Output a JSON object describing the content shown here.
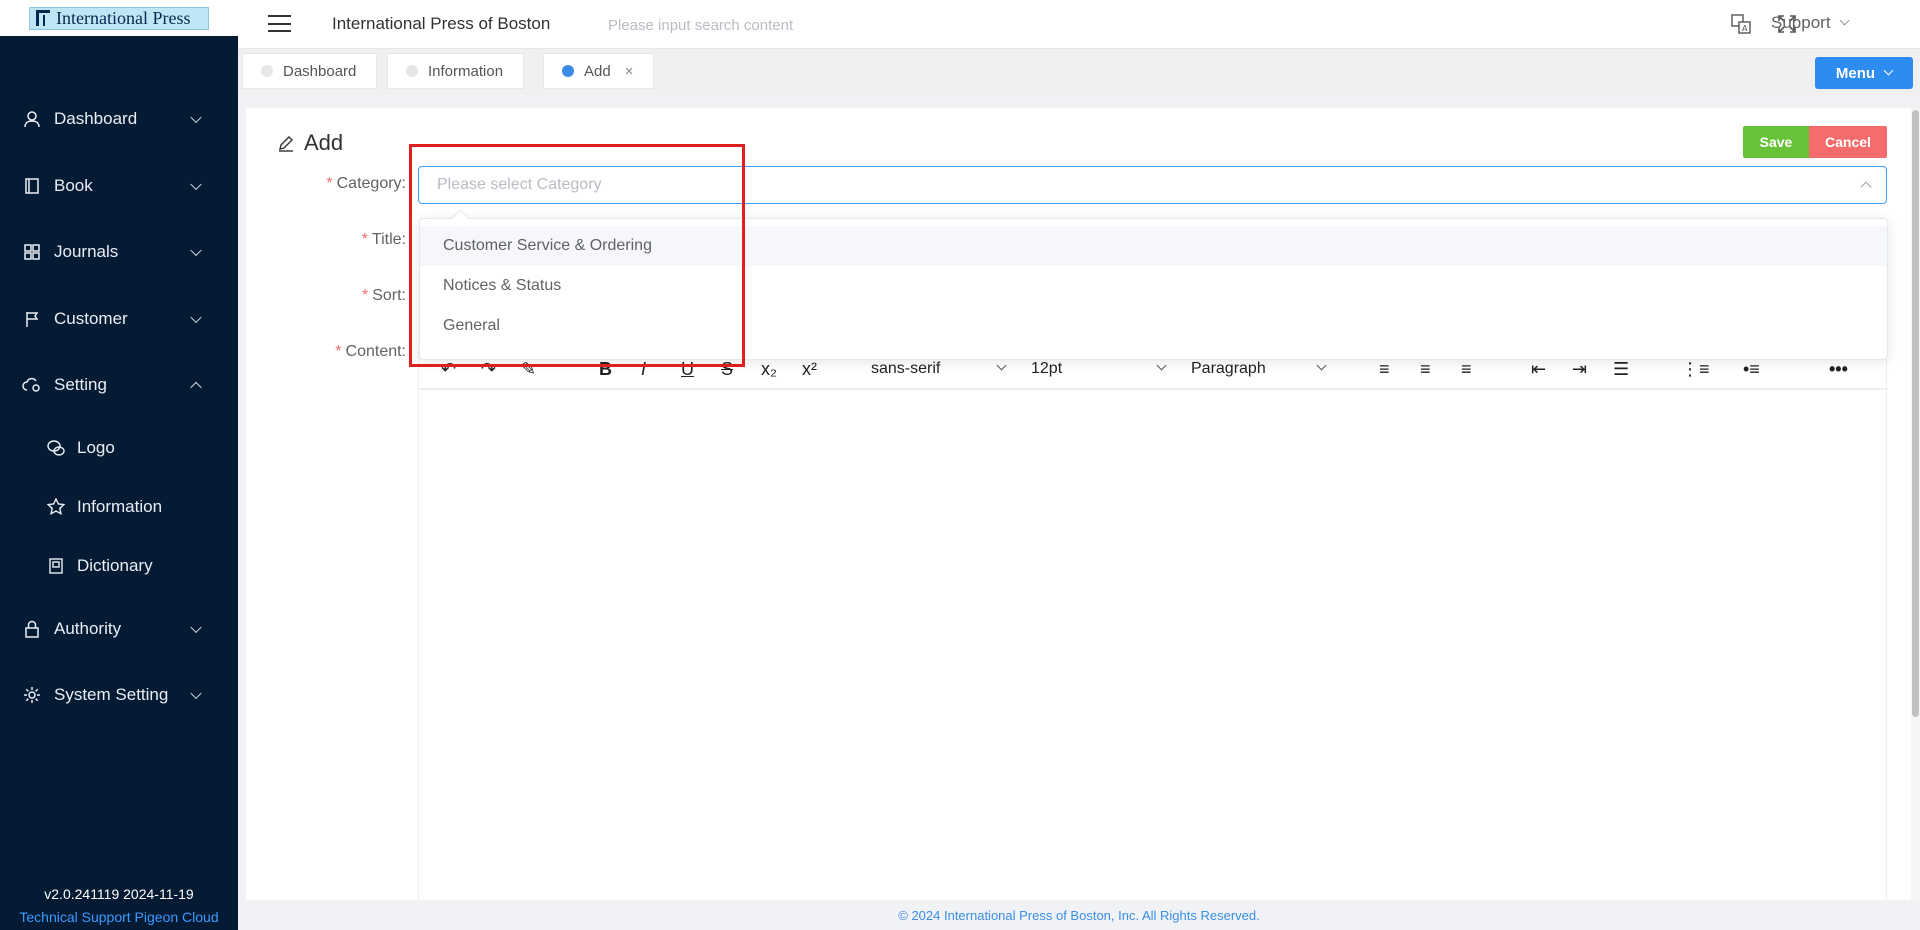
{
  "logo": {
    "text": "International Press"
  },
  "sidebar": {
    "items": [
      {
        "label": "Dashboard",
        "icon": "user-icon"
      },
      {
        "label": "Book",
        "icon": "book-icon"
      },
      {
        "label": "Journals",
        "icon": "grid-icon"
      },
      {
        "label": "Customer",
        "icon": "flag-icon"
      },
      {
        "label": "Setting",
        "icon": "cloud-gear-icon",
        "expanded": true
      }
    ],
    "sub_items": [
      {
        "label": "Logo",
        "icon": "chat-icon"
      },
      {
        "label": "Information",
        "icon": "star-icon"
      },
      {
        "label": "Dictionary",
        "icon": "notebook-icon"
      }
    ],
    "items_after": [
      {
        "label": "Authority",
        "icon": "lock-icon"
      },
      {
        "label": "System Setting",
        "icon": "gear-icon"
      }
    ],
    "version": "v2.0.241119 2024-11-19",
    "support_link": "Technical Support Pigeon Cloud"
  },
  "header": {
    "title": "International Press of Boston",
    "search_placeholder": "Please input search content",
    "support_label": "Support"
  },
  "tabs": [
    {
      "label": "Dashboard",
      "active": false
    },
    {
      "label": "Information",
      "active": false
    },
    {
      "label": "Add",
      "active": true,
      "close": "×"
    }
  ],
  "menu_button": "Menu",
  "page": {
    "heading": "Add",
    "save_label": "Save",
    "cancel_label": "Cancel",
    "fields": {
      "category_label": "Category:",
      "title_label": "Title:",
      "sort_label": "Sort:",
      "content_label": "Content:",
      "required_mark": "*"
    },
    "category_placeholder": "Please select Category"
  },
  "category_options": [
    "Customer Service & Ordering",
    "Notices & Status",
    "General"
  ],
  "editor": {
    "font_family": "sans-serif",
    "font_size": "12pt",
    "block_format": "Paragraph"
  },
  "footer": {
    "text": "© 2024 International Press of Boston, Inc. All Rights Reserved."
  },
  "colors": {
    "sidebar_bg": "#051a33",
    "primary": "#2d8cf0",
    "save": "#67c23a",
    "cancel": "#f56c6c",
    "highlight": "#e02020"
  }
}
